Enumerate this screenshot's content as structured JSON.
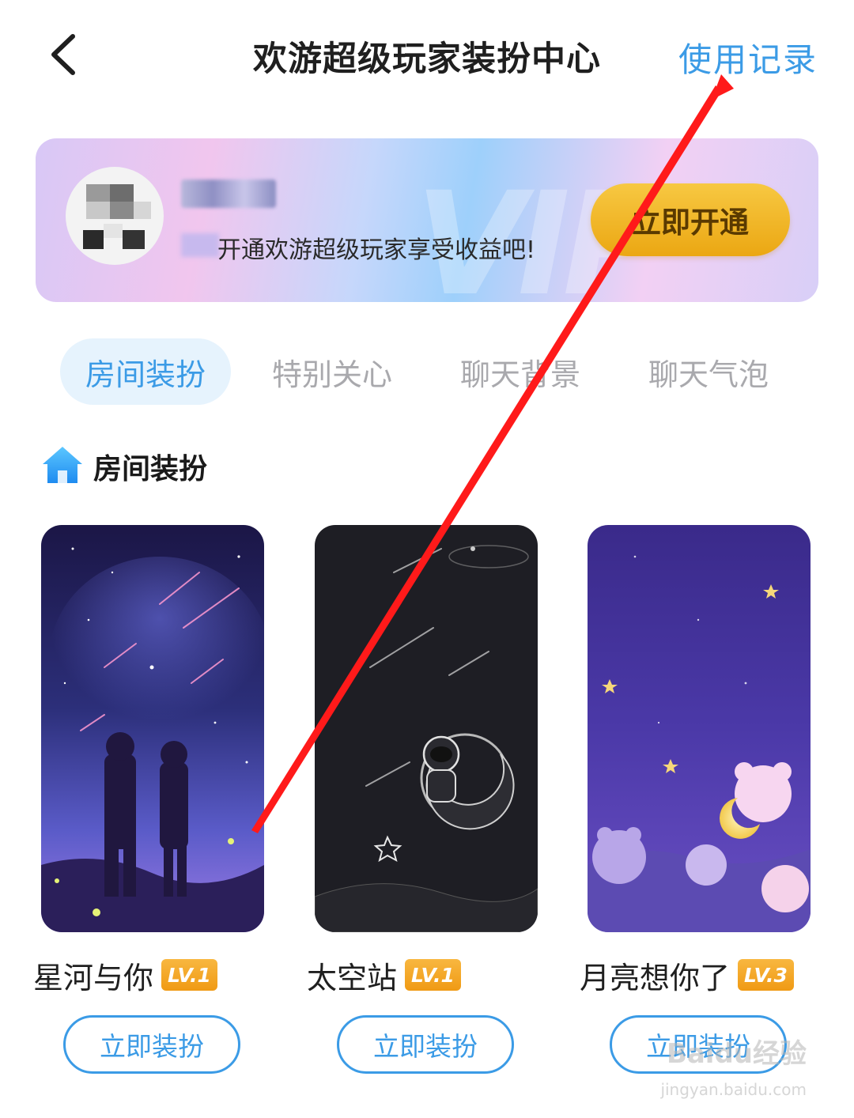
{
  "header": {
    "title": "欢游超级玩家装扮中心",
    "history_label": "使用记录"
  },
  "vip_card": {
    "promo_text": "开通欢游超级玩家享受收益吧!",
    "open_button": "立即开通"
  },
  "tabs": [
    {
      "label": "房间装扮",
      "active": true
    },
    {
      "label": "特别关心",
      "active": false
    },
    {
      "label": "聊天背景",
      "active": false
    },
    {
      "label": "聊天气泡",
      "active": false
    }
  ],
  "section": {
    "title": "房间装扮",
    "icon": "house-icon"
  },
  "items": [
    {
      "name": "星河与你",
      "level": "LV.1",
      "button": "立即装扮"
    },
    {
      "name": "太空站",
      "level": "LV.1",
      "button": "立即装扮"
    },
    {
      "name": "月亮想你了",
      "level": "LV.3",
      "button": "立即装扮"
    }
  ],
  "watermark": {
    "brand": "Baidu经验",
    "url": "jingyan.baidu.com"
  },
  "colors": {
    "accent": "#3b9be6",
    "annotation": "#ff1a1a",
    "gold": "#f2b21f"
  }
}
